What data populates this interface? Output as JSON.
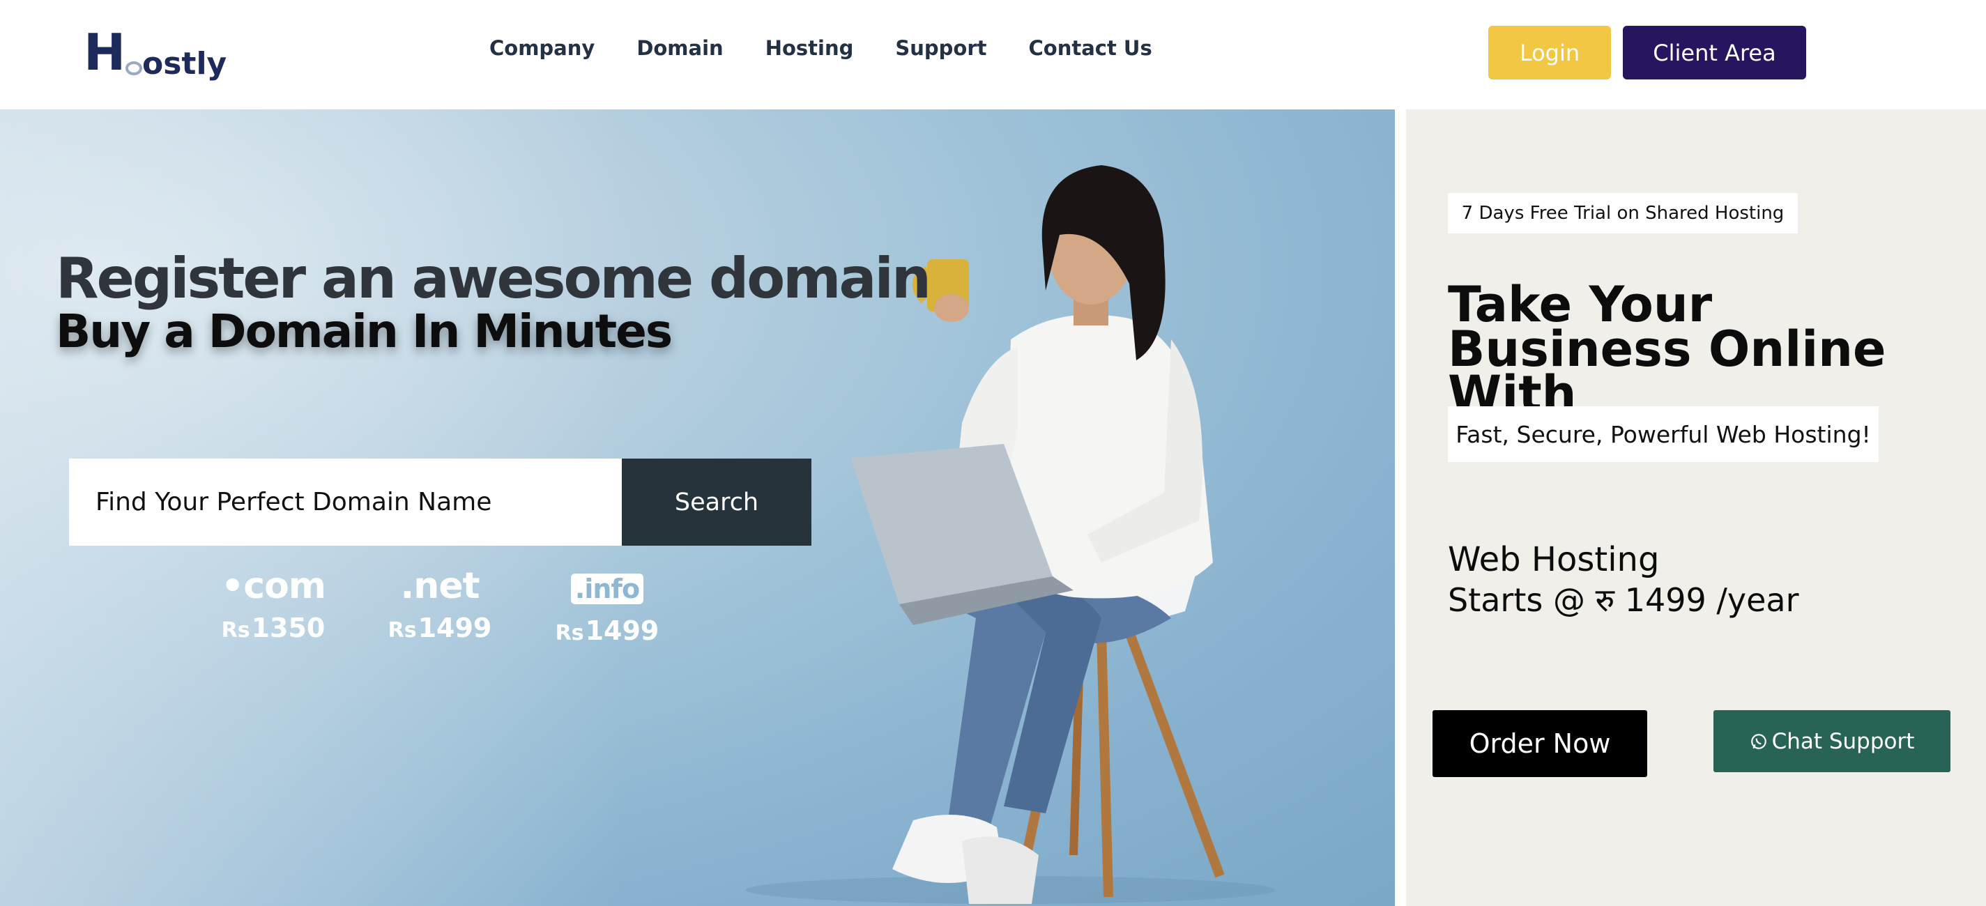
{
  "header": {
    "logo_text": "Hoostly",
    "nav": [
      "Company",
      "Domain",
      "Hosting",
      "Support",
      "Contact Us"
    ],
    "login_label": "Login",
    "client_area_label": "Client Area"
  },
  "hero": {
    "headline": "Register an awesome domain",
    "subheadline": "Buy a Domain In Minutes",
    "search_placeholder": "Find Your Perfect Domain Name",
    "search_button": "Search",
    "tlds": [
      {
        "name": "•com",
        "currency": "Rs",
        "price": "1350"
      },
      {
        "name": ".net",
        "currency": "Rs",
        "price": "1499"
      },
      {
        "name": ".info",
        "currency": "Rs",
        "price": "1499"
      }
    ]
  },
  "side": {
    "badge": "7 Days Free Trial on Shared Hosting",
    "title": "Take Your Business Online With",
    "tagline": "Fast, Secure, Powerful Web Hosting!",
    "hosting_title": "Web Hosting",
    "hosting_price": "Starts @ रु 1499 /year",
    "order_button": "Order Now",
    "chat_button": "Chat Support"
  },
  "colors": {
    "login": "#f2c744",
    "client_area": "#28155f",
    "search_button": "#27333b",
    "chat_button": "#286455",
    "side_bg": "#f0efe9"
  }
}
